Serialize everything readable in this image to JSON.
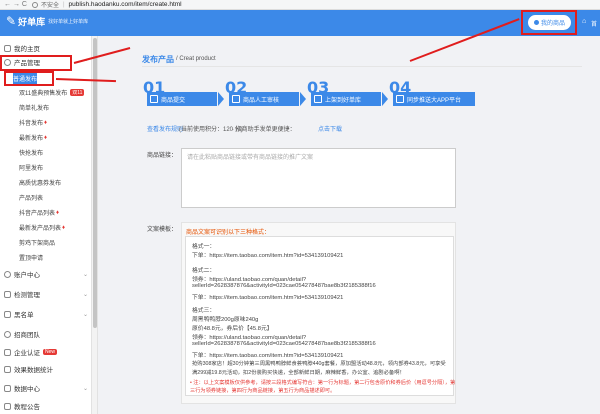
{
  "browser": {
    "nav": "←  →  C",
    "secure_label": "不安全",
    "url": "publish.haodanku.com/item/create.html"
  },
  "header": {
    "logo_text": "好单库",
    "slogan": "找好单就上好单库",
    "goods_button": "我的商品",
    "home_label": "首"
  },
  "sidebar": {
    "items": [
      {
        "label": "我的主页"
      },
      {
        "label": "产品管理"
      }
    ],
    "subitems": [
      {
        "label": "普通发布",
        "active": true
      },
      {
        "label": "双11盛典预售发布",
        "badge": "双11"
      },
      {
        "label": "简单礼发布"
      },
      {
        "label": "抖音发布",
        "hot": true
      },
      {
        "label": "最新发布",
        "hot": true
      },
      {
        "label": "快抢发布"
      },
      {
        "label": "阿里发布"
      },
      {
        "label": "高质优惠券发布"
      },
      {
        "label": "产品列表"
      },
      {
        "label": "抖音产品列表",
        "hot": true
      },
      {
        "label": "最新发产品列表",
        "hot": true
      },
      {
        "label": "剪鸡下架商品"
      },
      {
        "label": "置顶申请"
      }
    ],
    "groups": [
      {
        "label": "账户中心"
      },
      {
        "label": "检测管理"
      },
      {
        "label": "黑名单"
      },
      {
        "label": "招商团队"
      },
      {
        "label": "企业认证",
        "badge": "New"
      },
      {
        "label": "效果数据统计"
      },
      {
        "label": "数据中心"
      },
      {
        "label": "教程公告"
      }
    ]
  },
  "main": {
    "title": "发布产品",
    "breadcrumb": "/ Creat product",
    "steps": [
      {
        "num": "01",
        "label": "商品提交"
      },
      {
        "num": "02",
        "label": "商品人工审核"
      },
      {
        "num": "03",
        "label": "上架到好单库"
      },
      {
        "num": "04",
        "label": "同步推送大APP平台"
      }
    ],
    "rules_link": "查看发布规则",
    "integral": "(当前使用积分：120 分)",
    "plugin_text": "· 招商助手发单更便捷：",
    "plugin_link": "点击下载",
    "link_label": "商品链接：",
    "link_placeholder": "请在此粘贴商品链接或带有商品链接的推广文案",
    "format_label": "文案模板：",
    "format_head": "商品文案可识别以下三种格式：",
    "format_lines": [
      "格式一：",
      "下单：https://item.taobao.com/item.htm?id=534139109421",
      "格式二：",
      "领券：https://uland.taobao.com/quan/detail?",
      "sellerId=2628387876&activityId=023cae054278487bae8b3f2185388f16",
      "下单：https://item.taobao.com/item.htm?id=534139109421",
      "格式三：",
      "周黑鸭鸭脖200g原味240g",
      "原价48.8元，券后价【45.8元】",
      "领券：https://uland.taobao.com/quan/detail?",
      "sellerId=2628387876&activityId=023cae054278487bae8b3f2185388f16",
      "下单：https://item.taobao.com/item.htm?id=534139109421",
      "抢购308家店！超30分钟第三周黑鸭鸭脖鲜食荟鸭脖440g套餐，原加盟活动48.8元，领内部券43.8元，可享受",
      "满299减19.8元活动，扣2份装购买快递，全部新鲜日期，麻辣鲜香，办公室、追剧必备啊！"
    ],
    "format_note_1": "• 注：以上文案模板仅供参考，请按三段格式编写符合：第一行为标题，第二行包含原价和券后价（用逗号分隔），第",
    "format_note_2": "三行为领券链接，第四行为商品链接，第五行为商品描述即可。"
  }
}
